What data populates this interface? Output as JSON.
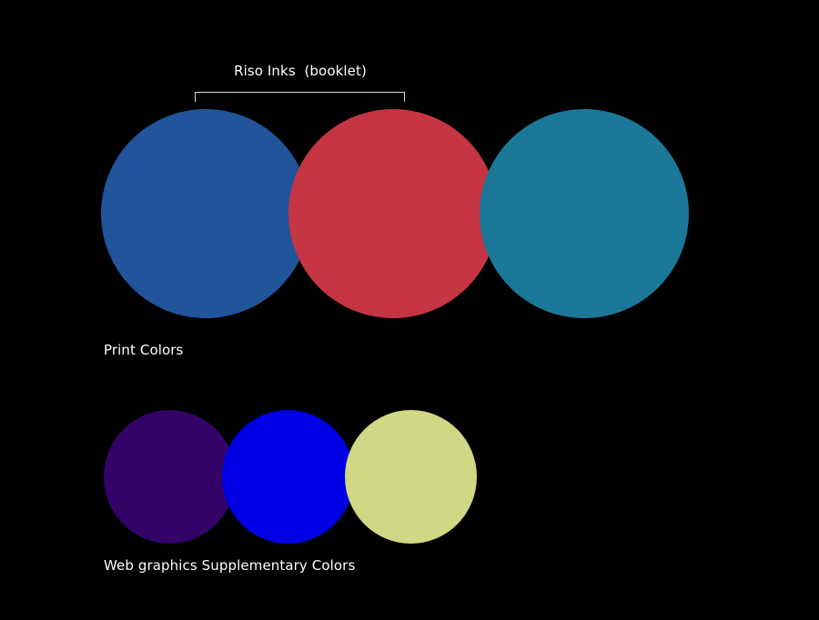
{
  "print_section": {
    "bracket_label": "Riso Inks  (booklet)",
    "label": "Print Colors",
    "swatches": [
      {
        "name": "blue",
        "color": "#21549A"
      },
      {
        "name": "red",
        "color": "#C63544"
      },
      {
        "name": "teal",
        "color": "#1C7898"
      }
    ]
  },
  "web_section": {
    "label": "Web graphics Supplementary Colors",
    "swatches": [
      {
        "name": "purple",
        "color": "#330367"
      },
      {
        "name": "blue",
        "color": "#0000E5"
      },
      {
        "name": "yellow",
        "color": "#D0D785"
      }
    ]
  }
}
